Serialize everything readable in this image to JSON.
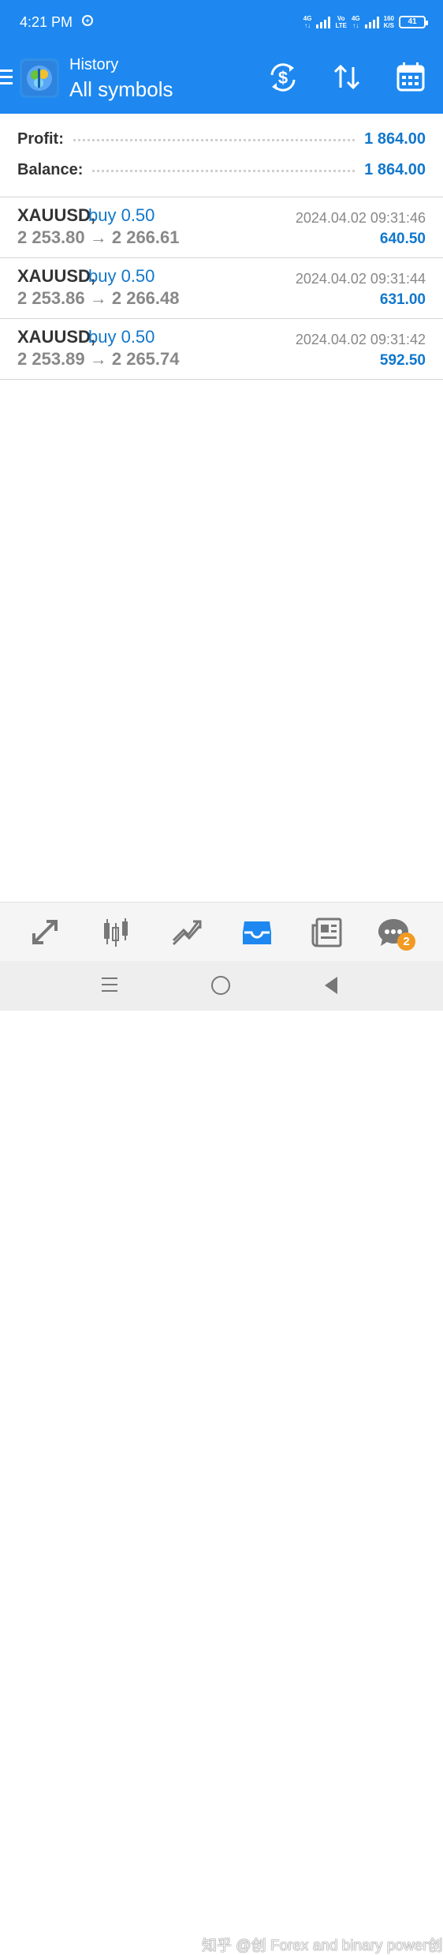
{
  "status_bar": {
    "time": "4:21 PM",
    "network_1": "4G",
    "volte_top": "Vo",
    "volte_bottom": "LTE",
    "network_2": "4G",
    "speed_top": "160",
    "speed_bottom": "K/S",
    "battery": "41"
  },
  "app_bar": {
    "title": "History",
    "subtitle": "All symbols",
    "icons": [
      "menu-icon",
      "app-logo",
      "currency-exchange-icon",
      "sort-icon",
      "calendar-icon"
    ]
  },
  "summary": {
    "profit_label": "Profit:",
    "profit_value": "1 864.00",
    "balance_label": "Balance:",
    "balance_value": "1 864.00"
  },
  "trades": [
    {
      "symbol": "XAUUSD,",
      "side": "buy 0.50",
      "prices": "2 253.80 → 2 266.61",
      "time": "2024.04.02 09:31:46",
      "profit": "640.50"
    },
    {
      "symbol": "XAUUSD,",
      "side": "buy 0.50",
      "prices": "2 253.86 → 2 266.48",
      "time": "2024.04.02 09:31:44",
      "profit": "631.00"
    },
    {
      "symbol": "XAUUSD,",
      "side": "buy 0.50",
      "prices": "2 253.89 → 2 265.74",
      "time": "2024.04.02 09:31:42",
      "profit": "592.50"
    }
  ],
  "bottom_nav": {
    "items": [
      "quotes-icon",
      "chart-icon",
      "trade-icon",
      "history-icon",
      "news-icon",
      "chat-icon"
    ],
    "chat_badge": "2"
  },
  "watermark": "知乎 @创 Forex and binary power创",
  "colors": {
    "primary": "#1e88f0",
    "accent_text": "#1177cc",
    "muted_text": "#888888",
    "badge": "#f39a23"
  }
}
